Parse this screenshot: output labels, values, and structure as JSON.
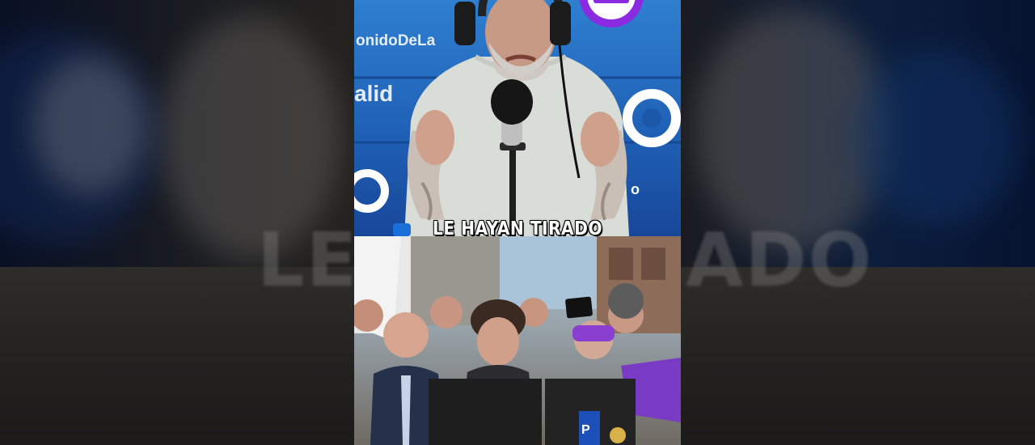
{
  "video": {
    "caption": "LE HAYAN TIRADO",
    "background_caption_left": "LE I",
    "background_caption_right": "ADO",
    "studio_wall_text_1": "onidoDeLa",
    "studio_wall_text_2": "alid"
  },
  "colors": {
    "studio_blue": "#1f61b6",
    "logo_purple": "#8a2be2",
    "caption_text": "#ffffff",
    "caption_outline": "#000000"
  },
  "icons": [
    "channel-logo-icon",
    "microphone-icon"
  ]
}
